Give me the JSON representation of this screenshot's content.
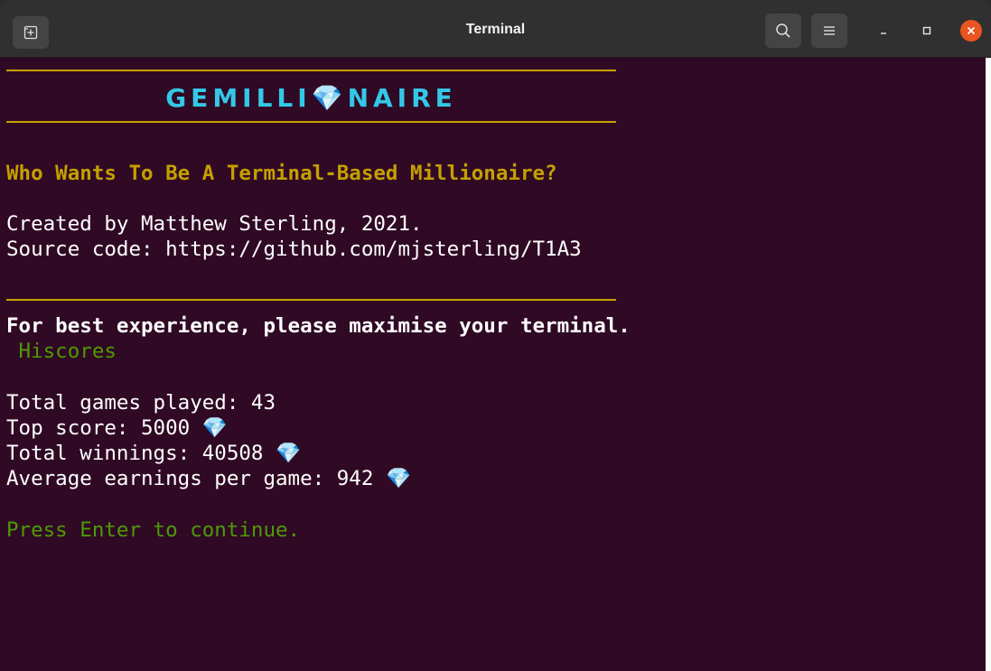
{
  "window": {
    "title": "Terminal",
    "icons": {
      "new_tab": "new-tab-icon",
      "search": "search-icon",
      "menu": "hamburger-menu-icon",
      "minimize": "minimize-icon",
      "maximize": "maximize-icon",
      "close": "close-icon"
    }
  },
  "terminal": {
    "banner_left": "GEMILLI",
    "banner_gem": "💎",
    "banner_right": "NAIRE",
    "subtitle": "Who Wants To Be A Terminal-Based Millionaire?",
    "credit": "Created by Matthew Sterling, 2021.",
    "source": "Source code: https://github.com/mjsterling/T1A3",
    "advice": "For best experience, please maximise your terminal.",
    "hiscores_heading": " Hiscores",
    "stats": {
      "games_played": "Total games played: 43",
      "top_score": "Top score: 5000",
      "total_winnings": "Total winnings: 40508",
      "average_earnings": "Average earnings per game: 942",
      "gem": "💎"
    },
    "prompt": "Press Enter to continue."
  },
  "colors": {
    "background": "#300a24",
    "rule": "#c4a000",
    "banner": "#34c8e8",
    "heading_yellow": "#c4a000",
    "green": "#4e9a06",
    "close_button": "#e95420"
  }
}
